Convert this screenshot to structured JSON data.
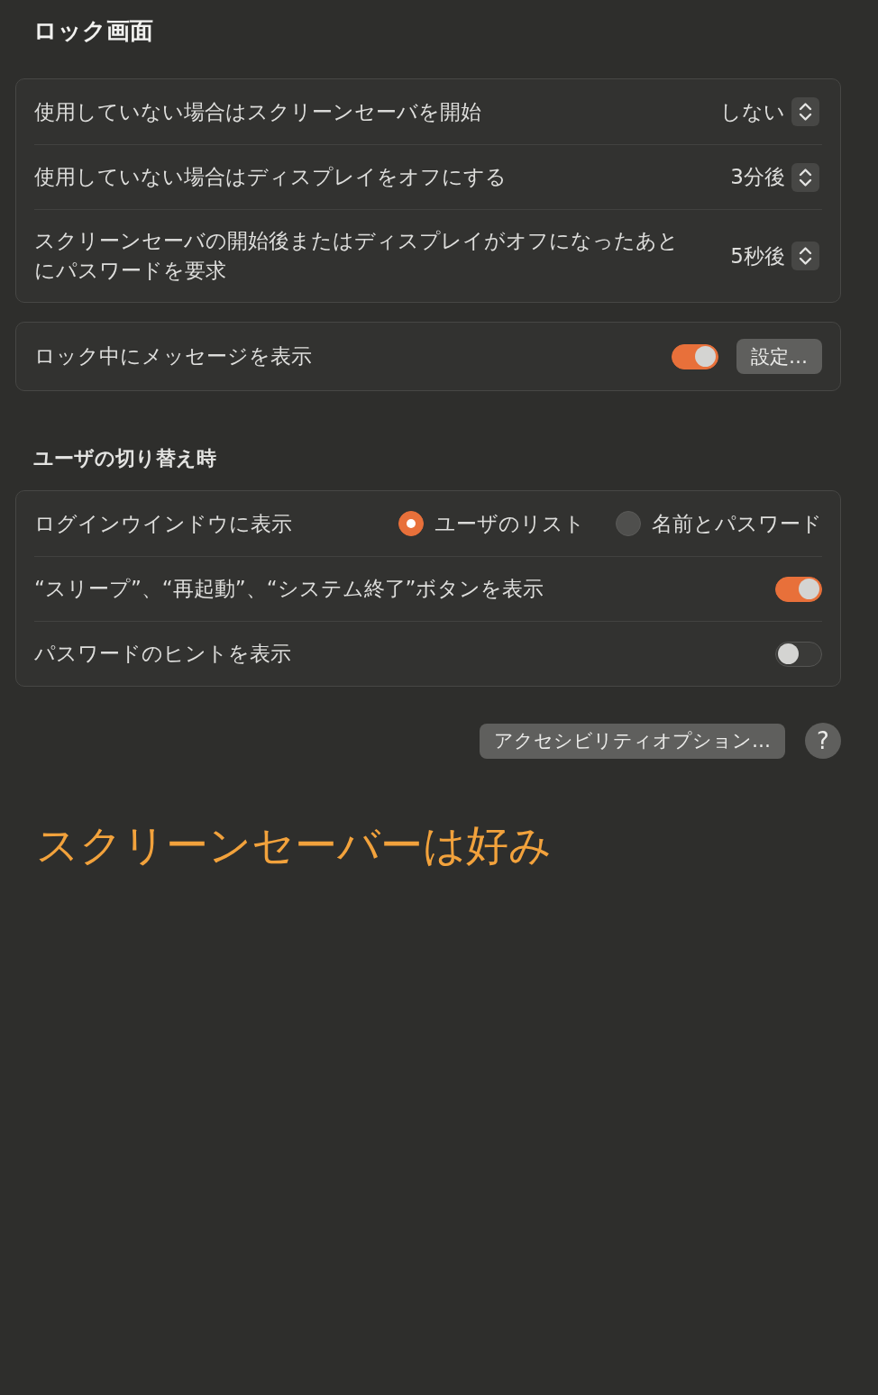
{
  "title": "ロック画面",
  "lock_screen_card": {
    "rows": [
      {
        "kind": "popup",
        "label": "使用していない場合はスクリーンセーバを開始",
        "value": "しない"
      },
      {
        "kind": "popup",
        "label": "使用していない場合はディスプレイをオフにする",
        "value": "3分後"
      },
      {
        "kind": "popup",
        "label": "スクリーンセーバの開始後またはディスプレイがオフになったあとにパスワードを要求",
        "value": "5秒後"
      }
    ]
  },
  "message_card": {
    "rows": [
      {
        "kind": "toggle",
        "label": "ロック中にメッセージを表示",
        "on": true,
        "button": "設定…"
      }
    ]
  },
  "user_switching": {
    "heading": "ユーザの切り替え時",
    "rows": [
      {
        "kind": "radio",
        "label": "ログインウインドウに表示",
        "options": [
          {
            "label": "ユーザのリスト",
            "selected": true
          },
          {
            "label": "名前とパスワード",
            "selected": false
          }
        ]
      },
      {
        "kind": "toggle",
        "label": "“スリープ”、“再起動”、“システム終了”ボタンを表示",
        "on": true
      },
      {
        "kind": "toggle",
        "label": "パスワードのヒントを表示",
        "on": false
      }
    ]
  },
  "actions": {
    "accessibility_button": "アクセシビリティオプション…",
    "help_button": "?"
  },
  "caption": "スクリーンセーバーは好み"
}
